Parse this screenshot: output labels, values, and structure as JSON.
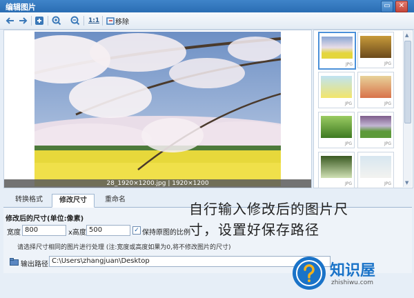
{
  "window": {
    "title": "编辑图片"
  },
  "toolbar": {
    "remove_label": "移除",
    "zoom_ratio_label": "1:1"
  },
  "viewer": {
    "caption": "28_1920×1200.jpg | 1920×1200"
  },
  "thumbnails": [
    {
      "ext": "JPG"
    },
    {
      "ext": "JPG"
    },
    {
      "ext": "JPG"
    },
    {
      "ext": "JPG"
    },
    {
      "ext": "JPG"
    },
    {
      "ext": "JPG"
    },
    {
      "ext": "JPG"
    },
    {
      "ext": "JPG"
    }
  ],
  "tabs": [
    {
      "label": "转换格式"
    },
    {
      "label": "修改尺寸"
    },
    {
      "label": "重命名"
    }
  ],
  "resize": {
    "section_title": "修改后的尺寸(单位:像素)",
    "width_label": "宽度",
    "width_value": "800",
    "height_label": "x高度",
    "height_value": "500",
    "keep_ratio_label": "保持原图的比例",
    "hint": "请选择尺寸相同的图片进行处理 (注:宽度或高度如果为0,将不修改图片的尺寸)"
  },
  "output": {
    "label": "输出路径",
    "path": "C:\\Users\\zhangjuan\\Desktop"
  },
  "overlay": {
    "line1": "自行输入修改后的图片尺",
    "line2": "寸，设置好保存路径"
  },
  "brand": {
    "name": "知识屋",
    "url": "zhishiwu.com"
  },
  "colors": {
    "accent": "#2a6db3",
    "brand": "#1a73c8"
  }
}
